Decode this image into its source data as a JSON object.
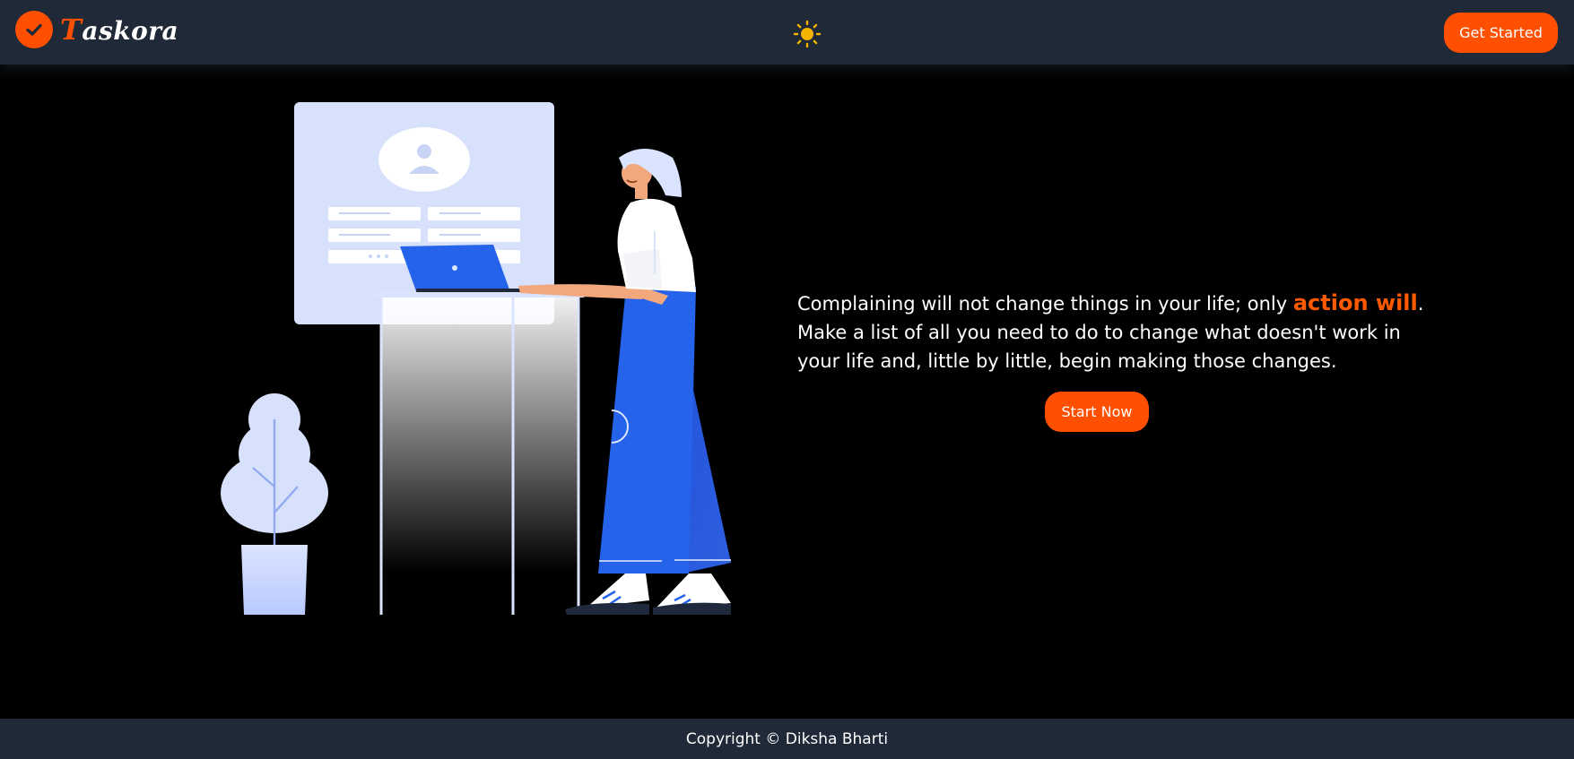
{
  "header": {
    "logo_initial": "T",
    "logo_rest": "askora",
    "get_started_label": "Get Started"
  },
  "icons": {
    "logo": "checkmark-icon",
    "theme_toggle": "sun-icon"
  },
  "hero": {
    "quote_part1": "Complaining will not change things in your life; only ",
    "quote_accent": "action will",
    "quote_part2": ". Make a list of all you need to do to change what doesn't work in your life and, little by little, begin making those changes.",
    "start_now_label": "Start Now"
  },
  "footer": {
    "copyright": "Copyright © Diksha Bharti"
  },
  "colors": {
    "accent": "#ff4f00",
    "header_bg": "#1f2937",
    "body_bg": "#000000",
    "sun": "#f5b400"
  }
}
